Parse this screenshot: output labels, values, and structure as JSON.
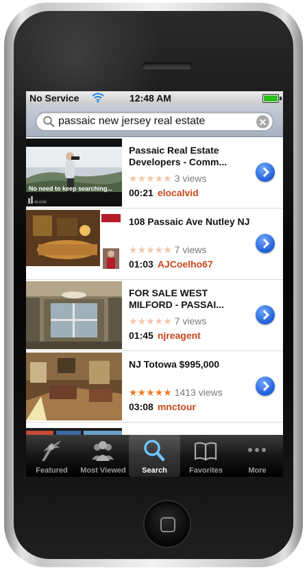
{
  "status_bar": {
    "carrier": "No Service",
    "time": "12:48 AM"
  },
  "search": {
    "query": "passaic new jersey real estate"
  },
  "results": [
    {
      "title": "Passaic Real Estate Developers - Comm...",
      "rating": 0,
      "views": "3 views",
      "duration": "00:21",
      "user": "elocalvid",
      "thumb_caption": "No need to keep searching..."
    },
    {
      "title": "108 Passaic Ave Nutley NJ",
      "rating": 0,
      "views": "7 views",
      "duration": "01:03",
      "user": "AJCoelho67"
    },
    {
      "title": "FOR SALE WEST MILFORD - PASSAI...",
      "rating": 0,
      "views": "7 views",
      "duration": "01:45",
      "user": "njreagent"
    },
    {
      "title": "NJ Totowa $995,000",
      "rating": 5,
      "views": "1413 views",
      "duration": "03:08",
      "user": "mnctour"
    }
  ],
  "stars_glyph": "★★★★★",
  "tabs": [
    {
      "label": "Featured",
      "icon": "featured-icon"
    },
    {
      "label": "Most Viewed",
      "icon": "most-viewed-icon"
    },
    {
      "label": "Search",
      "icon": "search-icon",
      "active": true
    },
    {
      "label": "Favorites",
      "icon": "favorites-icon"
    },
    {
      "label": "More",
      "icon": "more-icon"
    }
  ],
  "colors": {
    "accent": "#1f5fd6",
    "user": "#c8461a",
    "star_on": "#f07a22",
    "star_off": "#f2c5a8"
  }
}
